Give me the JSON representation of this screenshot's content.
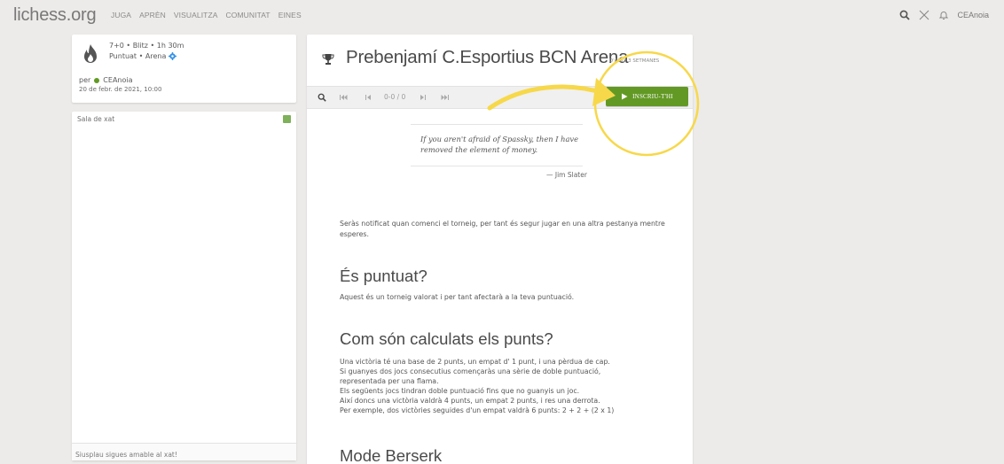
{
  "topbar": {
    "logo": "lichess.org",
    "nav": [
      "JUGA",
      "APRÈN",
      "VISUALITZA",
      "COMUNITAT",
      "EINES"
    ],
    "icons": [
      "search-icon",
      "swords-icon",
      "bell-icon"
    ],
    "username": "CEAnoia"
  },
  "info": {
    "line1": "7+0 • Blitz • 1h 30m",
    "line2": "Puntuat • Arena",
    "per_label": "per",
    "creator": "CEAnoia",
    "date": "20 de febr. de 2021, 10:00"
  },
  "chat": {
    "title": "Sala de xat",
    "placeholder": "Siusplau sigues amable al xat!"
  },
  "tournament": {
    "title": "Prebenjamí C.Esportius BCN Arena",
    "starts_in": "D'AQUÍ 3 SETMANES",
    "counter": "0-0 / 0",
    "join_label": "INSCRIU-T'HI"
  },
  "quote": {
    "text": "If you aren't afraid of Spassky, then I have removed the element of money.",
    "author": "— Jim Slater"
  },
  "content": {
    "notify": "Seràs notificat quan comenci el torneig, per tant és segur jugar en una altra pestanya mentre esperes.",
    "rated_heading": "És puntuat?",
    "rated_text": "Aquest és un torneig valorat i per tant afectarà a la teva puntuació.",
    "points_heading": "Com són calculats els punts?",
    "points_lines": [
      "Una victòria té una base de 2 punts, un empat d' 1 punt, i una pèrdua de cap.",
      "Si guanyes dos jocs consecutius començaràs una sèrie de doble puntuació,",
      "representada per una flama.",
      "Els següents jocs tindran doble puntuació fins que no guanyis un joc.",
      "Així doncs una victòria valdrà 4 punts, un empat 2 punts, i res una derrota.",
      "Per exemple, dos victòries seguides d'un empat valdrà 6 punts: 2 + 2 + (2 x 1)"
    ],
    "berserk_heading": "Mode Berserk"
  },
  "colors": {
    "background": "#edebe9",
    "accent_green": "#629924",
    "annotation_yellow": "#f7d84a"
  }
}
